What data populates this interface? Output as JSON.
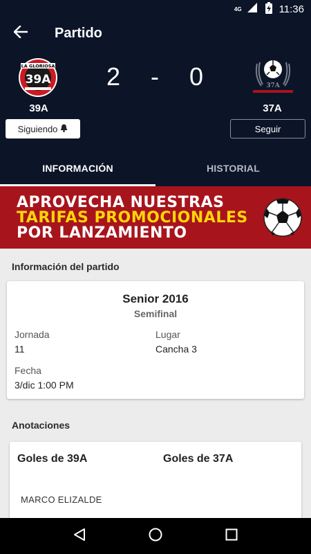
{
  "status_bar": {
    "network": "4G",
    "time": "11:36"
  },
  "appbar": {
    "title": "Partido"
  },
  "match": {
    "home": {
      "name": "39A",
      "logo_text_top": "LA GLORIOSA",
      "logo_text_main": "39A",
      "follow_label": "Siguiendo",
      "following": true
    },
    "away": {
      "name": "37A",
      "logo_text_main": "37A",
      "follow_label": "Seguir",
      "following": false
    },
    "home_score": "2",
    "separator": "-",
    "away_score": "0"
  },
  "tabs": [
    {
      "label": "INFORMACIÓN",
      "active": true
    },
    {
      "label": "HISTORIAL",
      "active": false
    }
  ],
  "banner": {
    "line1": "APROVECHA NUESTRAS",
    "line2": "TARIFAS PROMOCIONALES",
    "line3": "POR LANZAMIENTO"
  },
  "info_section": {
    "title": "Información del partido",
    "tournament": "Senior 2016",
    "stage": "Semifinal",
    "jornada_label": "Jornada",
    "jornada_value": "11",
    "lugar_label": "Lugar",
    "lugar_value": "Cancha 3",
    "fecha_label": "Fecha",
    "fecha_value": "3/dic 1:00 PM"
  },
  "annotations_section": {
    "title": "Anotaciones",
    "home_goals_label": "Goles de 39A",
    "away_goals_label": "Goles de 37A",
    "home_scorers": [
      "MARCO ELIZALDE"
    ]
  },
  "colors": {
    "header_bg": "#0c1428",
    "banner_bg": "#a8141c",
    "banner_accent": "#ffd60a",
    "page_bg": "#ececec"
  },
  "icons": {
    "back": "arrow-left-icon",
    "bell": "bell-icon",
    "nav_back": "triangle-back-icon",
    "nav_home": "circle-home-icon",
    "nav_recent": "square-recent-icon"
  }
}
